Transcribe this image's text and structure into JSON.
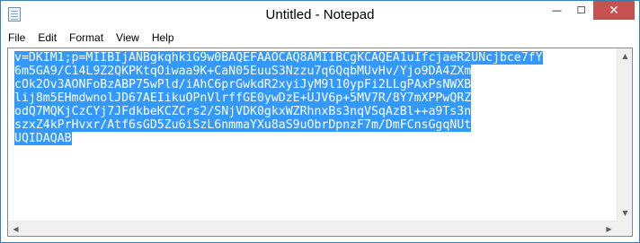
{
  "window": {
    "title": "Untitled - Notepad",
    "controls": {
      "minimize": "—",
      "maximize": "☐",
      "close": "✕"
    }
  },
  "menu": {
    "items": [
      "File",
      "Edit",
      "Format",
      "View",
      "Help"
    ]
  },
  "editor": {
    "selected": true,
    "selection_color": "#3399ff",
    "lines": [
      "v=DKIM1;p=MIIBIjANBgkqhkiG9w0BAQEFAAOCAQ8AMIIBCgKCAQEA1uIfcjaeR2UNcjbce7fY",
      "6m5GA9/C14L9Z2QKPKtqOiwaa9K+CaN05EuuS3Nzzu7q6QqbMUvHv/Yjo9DA4ZXm",
      "cOk2Ov3AONFoBzABP75wPld/iAhC6prGwkdR2xyiJyM9l10ypFi2LLgPAxPsNWXB",
      "lij8m5EHmdwnolJD67AEIikuOPnVlrffGE0ywDzE+UJV6p+5MV7R/8Y7mXPPwQRZ",
      "odQ7MQKjCzCYj7JFdkbeKCZCrs2/SNjVDK0gkxWZRhnxBs3nqVSqAzBl++a9Ts3n",
      "szxZ4kPrHvxr/Atf6sGD5Zu6iSzL6nmmaYXu8aS9uObrDpnzF7m/DmFCnsGgqNUt",
      "UQIDAQAB"
    ]
  },
  "scrollbars": {
    "up": "▲",
    "down": "▼",
    "left": "◀",
    "right": "▶"
  }
}
